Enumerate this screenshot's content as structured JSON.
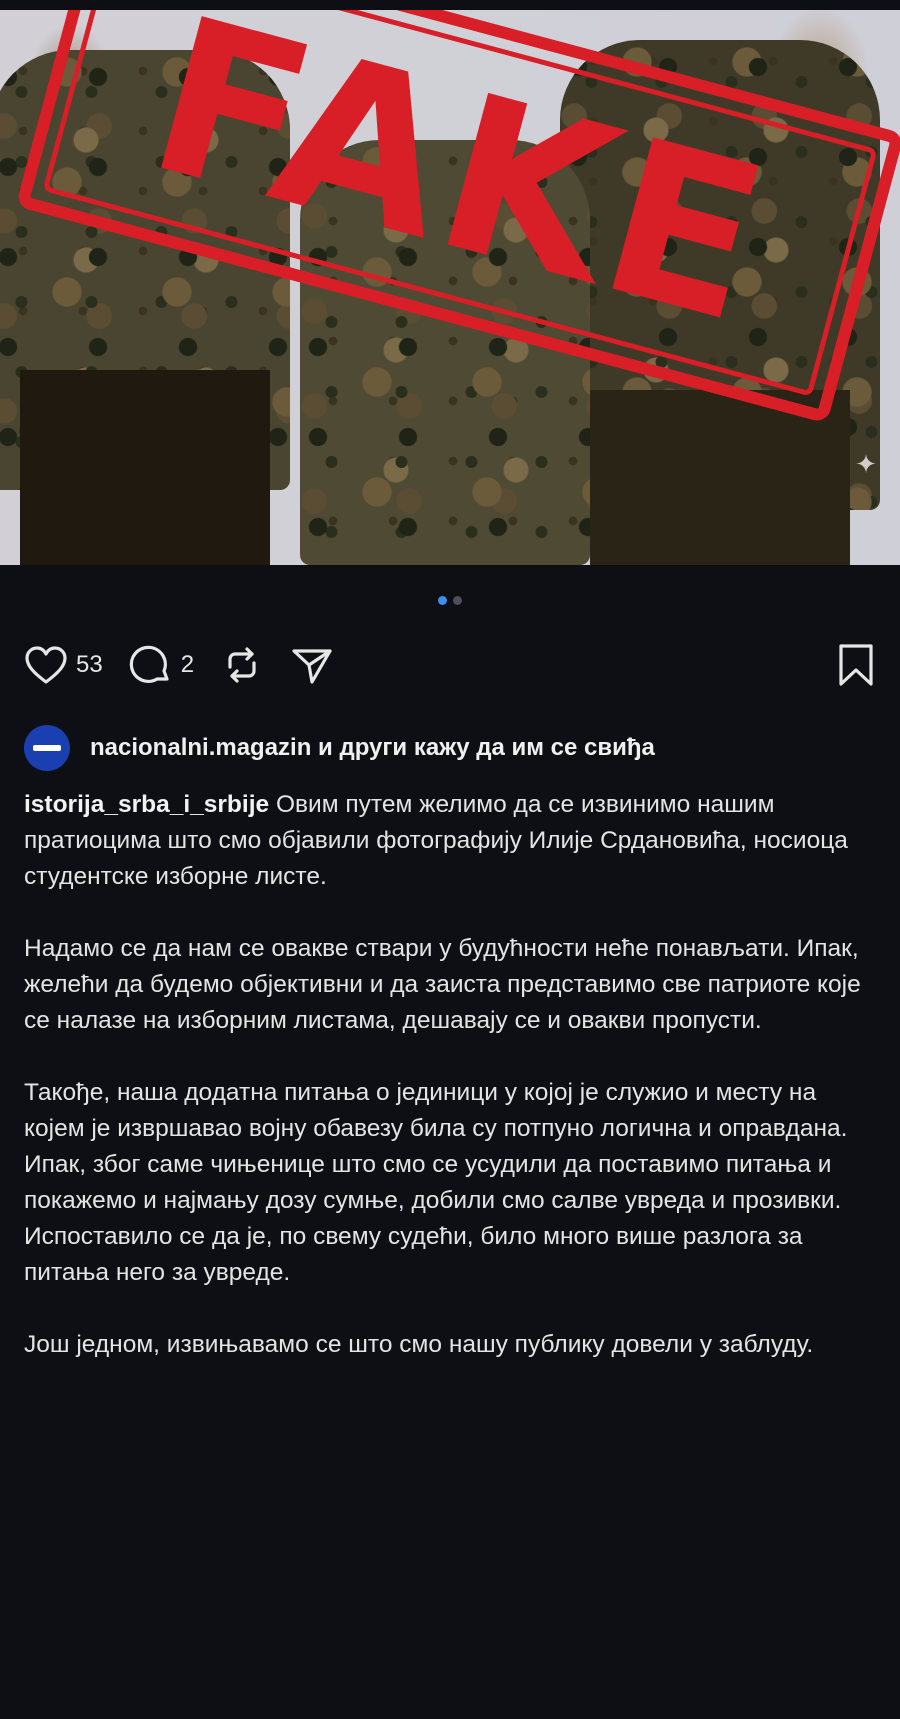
{
  "post": {
    "stamp_text": "FAKE",
    "carousel": {
      "total": 2,
      "active": 1
    },
    "actions": {
      "like_icon": "heart-icon",
      "likes": "53",
      "comment_icon": "comment-icon",
      "comments": "2",
      "repost_icon": "repost-icon",
      "share_icon": "send-icon",
      "save_icon": "bookmark-icon"
    },
    "liked_by": {
      "user": "nacionalni.magazin",
      "rest": " и други кажу да им се свиђа"
    },
    "caption": {
      "author": "istorija_srba_i_srbije",
      "paragraphs": [
        "Овим путем желимо да се извинимо нашим пратиоцима што смо објавили фотографију Илије Срдановића, носиоца студентске изборне листе.",
        "Надамо се да нам се овакве ствари у будућности неће понављати. Ипак, желећи да будемо објективни и да заиста представимо све патриоте које се налазе на изборним листама, дешавају се и овакви пропусти.",
        "Такође, наша додатна питања о јединици у којој је служио и месту на којем је извршавао војну обавезу била су потпуно логична и оправдана. Ипак, због саме чињенице што смо се усудили да поставимо питања и покажемо и најмању дозу сумње, добили смо салве увреда и прозивки. Испоставило се да је, по свему судећи, било много више разлога за питања него за увреде.",
        "Још једном, извињавамо се што смо нашу публику довели у заблуду."
      ]
    }
  },
  "colors": {
    "background": "#0d0f14",
    "stamp": "#d81e26",
    "active_dot": "#3d8ef0",
    "avatar": "#1a3fb0"
  }
}
